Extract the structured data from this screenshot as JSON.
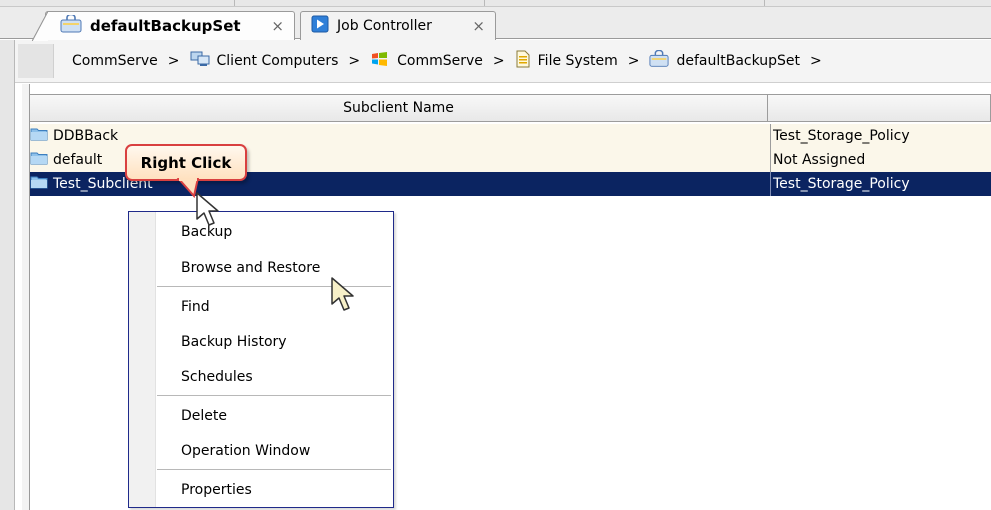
{
  "tabs": [
    {
      "label": "defaultBackupSet",
      "close": "×",
      "icon": "backupset-icon",
      "active": true
    },
    {
      "label": "Job Controller",
      "close": "×",
      "icon": "job-controller-icon",
      "active": false
    }
  ],
  "breadcrumb": {
    "items": [
      {
        "label": "CommServe",
        "icon": ""
      },
      {
        "label": "Client Computers",
        "icon": "client-computers-icon"
      },
      {
        "label": "CommServe",
        "icon": "windows-icon"
      },
      {
        "label": "File System",
        "icon": "file-system-icon"
      },
      {
        "label": "defaultBackupSet",
        "icon": "backupset-icon"
      }
    ],
    "separator": ">"
  },
  "table": {
    "columns": [
      "Subclient Name",
      ""
    ],
    "rows": [
      {
        "name": "DDBBack",
        "policy": "Test_Storage_Policy",
        "selected": false
      },
      {
        "name": "default",
        "policy": "Not Assigned",
        "selected": false
      },
      {
        "name": "Test_Subclient",
        "policy": "Test_Storage_Policy",
        "selected": true
      }
    ]
  },
  "callout": {
    "label": "Right Click"
  },
  "context_menu": {
    "items": [
      {
        "label": "Backup"
      },
      {
        "label": "Browse and Restore"
      },
      {
        "label": "Find"
      },
      {
        "label": "Backup History"
      },
      {
        "label": "Schedules"
      },
      {
        "label": "Delete"
      },
      {
        "label": "Operation Window"
      },
      {
        "label": "Properties"
      }
    ]
  },
  "colors": {
    "selection": "#0b2461",
    "row_background": "#fbf7ea",
    "callout_border": "#d94040",
    "menu_border": "#1f2a8a"
  }
}
